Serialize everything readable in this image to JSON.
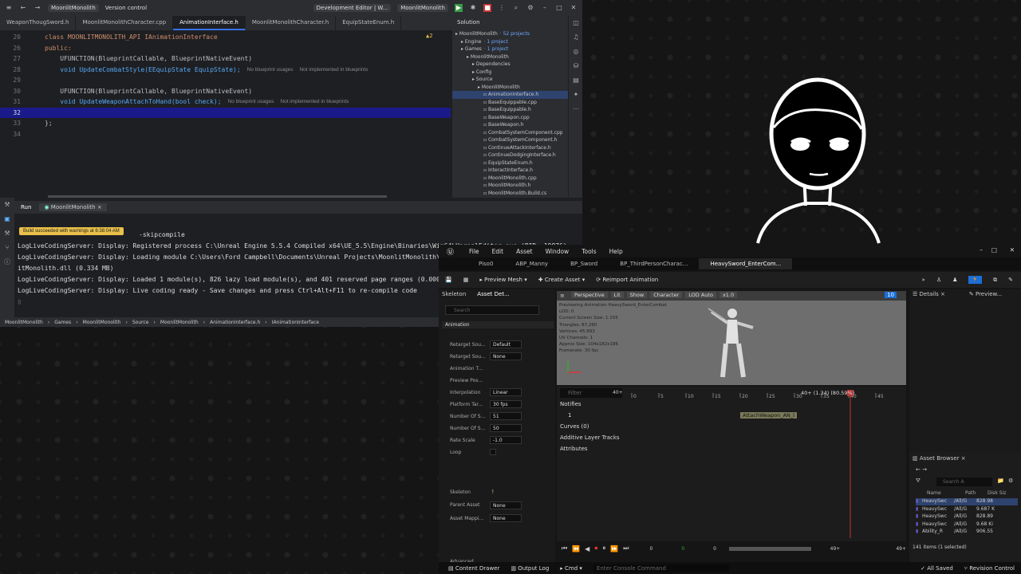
{
  "ide": {
    "project": "MoonlitMonolith",
    "vcs": "Version control",
    "config": "Development Editor | W...",
    "run_target": "MoonlitMonolith",
    "tabs": [
      "WeaponThougSword.h",
      "MoonlitMonolithCharacter.cpp",
      "AnimationInterface.h",
      "MoonlitMonolithCharacter.h",
      "EquipStateEnum.h"
    ],
    "warning_count": "2",
    "lines": [
      {
        "n": "20",
        "text": "class MOONLITMONOLITH_API IAnimationInterface"
      },
      {
        "n": "26",
        "text": "public:"
      },
      {
        "n": "27",
        "text": "    UFUNCTION(BlueprintCallable, BlueprintNativeEvent)"
      },
      {
        "n": "28",
        "text": "    void UpdateCombatStyle(EEquipState EquipState);",
        "ann1": "No blueprint usages",
        "ann2": "Not implemented in blueprints"
      },
      {
        "n": "29",
        "text": ""
      },
      {
        "n": "30",
        "text": "    UFUNCTION(BlueprintCallable, BlueprintNativeEvent)"
      },
      {
        "n": "31",
        "text": "    void UpdateWeaponAttachToHand(bool check);",
        "ann1": "No blueprint usages",
        "ann2": "Not implemented in blueprints"
      },
      {
        "n": "32",
        "text": ""
      },
      {
        "n": "33",
        "text": "};"
      },
      {
        "n": "34",
        "text": ""
      }
    ],
    "solution": {
      "title": "Solution",
      "items": [
        {
          "t": "MoonlitMonolith",
          "sub": "· 52 projects",
          "d": 0
        },
        {
          "t": "Engine",
          "sub": "· 1 project",
          "d": 1
        },
        {
          "t": "Games",
          "sub": "· 1 project",
          "d": 1
        },
        {
          "t": "MoonlitMonolith",
          "sub": "",
          "d": 2
        },
        {
          "t": "Dependencies",
          "sub": "",
          "d": 3
        },
        {
          "t": "Config",
          "sub": "",
          "d": 3
        },
        {
          "t": "Source",
          "sub": "",
          "d": 3
        },
        {
          "t": "MoonlitMonolith",
          "sub": "",
          "d": 4
        },
        {
          "t": "AnimationInterface.h",
          "sub": "",
          "d": 5,
          "sel": true
        },
        {
          "t": "BaseEquippable.cpp",
          "sub": "",
          "d": 5
        },
        {
          "t": "BaseEquippable.h",
          "sub": "",
          "d": 5
        },
        {
          "t": "BaseWeapon.cpp",
          "sub": "",
          "d": 5
        },
        {
          "t": "BaseWeapon.h",
          "sub": "",
          "d": 5
        },
        {
          "t": "CombatSystemComponent.cpp",
          "sub": "",
          "d": 5
        },
        {
          "t": "CombatSystemComponent.h",
          "sub": "",
          "d": 5
        },
        {
          "t": "ContinueAttackInterface.h",
          "sub": "",
          "d": 5
        },
        {
          "t": "ContinueDodgingInterface.h",
          "sub": "",
          "d": 5
        },
        {
          "t": "EquipStateEnum.h",
          "sub": "",
          "d": 5
        },
        {
          "t": "InteractInterface.h",
          "sub": "",
          "d": 5
        },
        {
          "t": "MoonlitMonolith.cpp",
          "sub": "",
          "d": 5
        },
        {
          "t": "MoonlitMonolith.h",
          "sub": "",
          "d": 5
        },
        {
          "t": "MoonlitMonolith.Build.cs",
          "sub": "",
          "d": 5
        }
      ]
    },
    "run": {
      "label": "Run",
      "config": "MoonlitMonolith"
    },
    "toast": "Build succeeded with warnings at 6:38:04 AM",
    "console": [
      "-skipcompile",
      "LogLiveCodingServer: Display: Registered process C:\\Unreal Engine 5.5.4 Compiled x64\\UE_5.5\\Engine\\Binaries\\Win64\\UnrealEditor.exe (PID: 19876)",
      "LogLiveCodingServer: Display: Loading module C:\\Users\\Ford Campbell\\Documents\\Unreal Projects\\MoonlitMonolith\\Binaries\\Win64\\UnrealEditor-Moon",
      "itMonolith.dll (0.334 MB)",
      "LogLiveCodingServer: Display: Loaded 1 module(s), 826 lazy load module(s), and 401 reserved page ranges (0.000s)",
      "LogLiveCodingServer: Display: Live coding ready - Save changes and press Ctrl+Alt+F11 to re-compile code"
    ],
    "breadcrumb": [
      "MoonlitMonolith",
      "Games",
      "MoonlitMonolith",
      "Source",
      "MoonlitMonolith",
      "AnimationInterface.h",
      "IAnimationInterface"
    ]
  },
  "ue": {
    "menu": [
      "File",
      "Edit",
      "Asset",
      "Window",
      "Tools",
      "Help"
    ],
    "tabs": [
      "Piso0",
      "ABP_Manny",
      "BP_Sword",
      "BP_ThirdPersonCharac...",
      "HeavySword_EnterCom..."
    ],
    "toolbar": {
      "preview_mesh": "Preview Mesh",
      "create_asset": "Create Asset",
      "reimport": "Reimport Animation"
    },
    "left_tabs": [
      "Skeleton",
      "Asset Det..."
    ],
    "search_placeholder": "Search",
    "section": "Animation",
    "props": [
      {
        "l": "Retarget Sou...",
        "v": "Default"
      },
      {
        "l": "Retarget Sou...",
        "v": "None"
      },
      {
        "l": "Animation T...",
        "v": ""
      },
      {
        "l": "Preview Pos...",
        "v": ""
      },
      {
        "l": "Interpolation",
        "v": "Linear"
      },
      {
        "l": "Platform Tar...",
        "v": "30 fps"
      },
      {
        "l": "Number Of S...",
        "v": "51"
      },
      {
        "l": "Number Of S...",
        "v": "50"
      },
      {
        "l": "Rate Scale",
        "v": "-1.0"
      },
      {
        "l": "Loop",
        "v": ""
      },
      {
        "l": "Skeleton",
        "v": ""
      },
      {
        "l": "Parent Asset",
        "v": "None"
      },
      {
        "l": "Asset Mappi...",
        "v": "None"
      },
      {
        "l": "Advanced",
        "v": ""
      }
    ],
    "viewport": {
      "btns": [
        "Perspective",
        "Lit",
        "Show",
        "Character",
        "LOD Auto",
        "x1.0"
      ],
      "fov": "10",
      "info": [
        "Previewing Animation HeavySword_EnterCombat",
        "LOD: 0",
        "Current Screen Size: 1.155",
        "Triangles: 87,260",
        "Vertices: 45,993",
        "UV Channels: 1",
        "Approx Size: 104x182x186",
        "Framerate: 30 fps"
      ]
    },
    "timeline": {
      "filter": "Filter",
      "frames": "40+",
      "ticks": [
        "0",
        "5",
        "10",
        "15",
        "20",
        "25",
        "30",
        "35",
        "40",
        "45"
      ],
      "current": "40+ (1.34) (80.59%)",
      "tracks": [
        "Notifies",
        "1",
        "Curves (0)",
        "Additive Layer Tracks",
        "Attributes"
      ],
      "notify": "AttachWeapon_AN_l",
      "transport_vals": [
        "0",
        "0",
        "0",
        "49+",
        "49+"
      ]
    },
    "right": {
      "details": "Details",
      "preview": "Preview...",
      "browser": "Asset Browser",
      "search": "Search A",
      "cols": [
        "Name",
        "Path",
        "Disk Siz"
      ],
      "rows": [
        [
          "HeavySwc",
          "/All/G",
          "828.98"
        ],
        [
          "HeavySwc",
          "/All/G",
          "9.687 K"
        ],
        [
          "HeavySwc",
          "/All/G",
          "828.89"
        ],
        [
          "HeavySwc",
          "/All/G",
          "9.68 Ki"
        ],
        [
          "Ability_R",
          "/All/G",
          "906.55"
        ]
      ],
      "count": "141 items (1 selected)"
    },
    "status": [
      "Content Drawer",
      "Output Log",
      "Cmd",
      "Enter Console Command",
      "All Saved",
      "Revision Control"
    ]
  }
}
